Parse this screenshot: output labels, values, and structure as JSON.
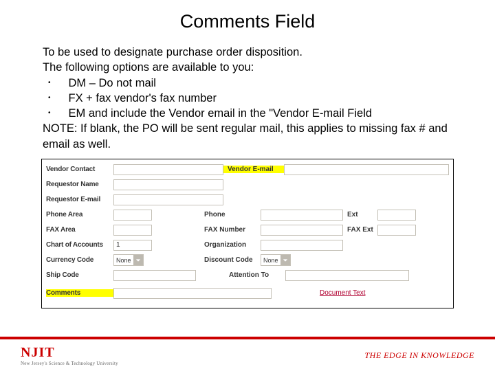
{
  "title": "Comments Field",
  "intro": {
    "l1": "To be used to designate purchase order disposition.",
    "l2": "The following options are available to you:",
    "b1": "DM – Do not mail",
    "b2": "FX + fax vendor's fax number",
    "b3": "EM and include the Vendor email in the \"Vendor E-mail Field",
    "note": "NOTE:  If blank, the PO will be sent regular mail, this applies to missing fax # and email as well."
  },
  "form": {
    "vendor_contact": "Vendor Contact",
    "vendor_email": "Vendor E-mail",
    "requestor_name": "Requestor Name",
    "requestor_email": "Requestor E-mail",
    "phone_area": "Phone Area",
    "phone": "Phone",
    "ext": "Ext",
    "fax_area": "FAX Area",
    "fax_number": "FAX Number",
    "fax_ext": "FAX Ext",
    "coa": "Chart of Accounts",
    "coa_val": "1",
    "organization": "Organization",
    "currency": "Currency Code",
    "currency_opt": "None",
    "discount": "Discount Code",
    "discount_opt": "None",
    "ship": "Ship Code",
    "attention": "Attention To",
    "comments": "Comments",
    "doc_text": "Document Text"
  },
  "footer": {
    "logo": "NJIT",
    "sub": "New Jersey's Science & Technology University",
    "tag": "THE EDGE IN KNOWLEDGE"
  }
}
